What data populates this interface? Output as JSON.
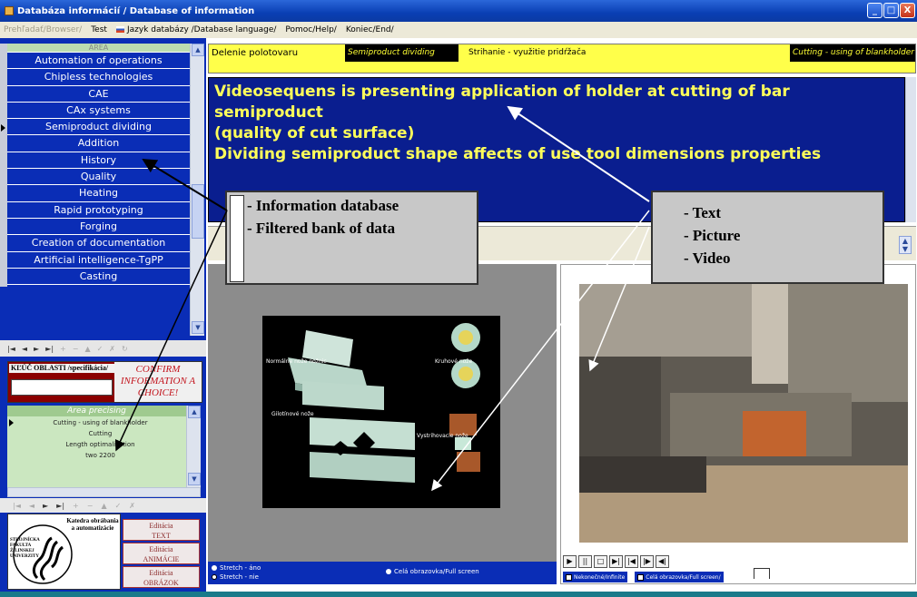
{
  "window": {
    "title": "Databáza informácií / Database of information",
    "controls": [
      "_",
      "□",
      "X"
    ]
  },
  "menu": {
    "items": [
      {
        "label": "Prehľadať/Browser/",
        "enabled": false
      },
      {
        "label": "Test",
        "enabled": true
      },
      {
        "label": "Jazyk databázy /Database language/",
        "enabled": true
      },
      {
        "label": "Pomoc/Help/",
        "enabled": true
      },
      {
        "label": "Koniec/End/",
        "enabled": true
      }
    ]
  },
  "area": {
    "header": "AREA",
    "items": [
      "Automation of operations",
      "Chipless technologies",
      "CAE",
      "CAx systems",
      "Semiproduct dividing",
      "Addition",
      "History",
      "Quality",
      "Heating",
      "Rapid prototyping",
      "Forging",
      "Creation of documentation",
      "Artificial intelligence-TgPP",
      "Casting"
    ],
    "selected_index": 4
  },
  "navigator": {
    "buttons": [
      "|◄",
      "◄",
      "►",
      "►|",
      "+",
      "−",
      "▲",
      "✓",
      "✗",
      "↻"
    ]
  },
  "key": {
    "label": "KĽÚČ OBLASTI /specifikácia/",
    "input_value": "",
    "confirm_text": "CONFIRM INFORMATION A CHOICE!"
  },
  "precising": {
    "header": "Area precising",
    "items": [
      "Cutting - using of blankholder",
      "Cutting",
      "Length optimalization",
      "two 2200"
    ],
    "selected_index": 0
  },
  "logo": {
    "title": "Katedra obrábania a automatizácie",
    "university": "STROJNÍCKA FAKULTA ŽILINSKEJ UNIVERZITY"
  },
  "edit_buttons": [
    {
      "line1": "Editácia",
      "line2": "TEXT"
    },
    {
      "line1": "Editácia",
      "line2": "ANIMÁCIE"
    },
    {
      "line1": "Editácia",
      "line2": "OBRÁZOK"
    }
  ],
  "text_header": {
    "area_sk": "Delenie polotovaru",
    "area_en": "Semiproduct dividing",
    "topic_sk": "Strihanie - využitie pridŕžača",
    "topic_en": "Cutting - using of blankholder"
  },
  "main_text": {
    "line1": "Videosequens is presenting application of holder at cutting of bar semiproduct",
    "line2": "(quality of cut surface)",
    "line3": "Dividing semiproduct shape affects of use tool dimensions properties"
  },
  "picture": {
    "labels": [
      "Normálne nože nožnic",
      "Kruhové nože",
      "Gilotínové nože",
      "Vystrihovacie nože"
    ]
  },
  "picture_controls": {
    "stretch_yes": "Stretch - áno",
    "stretch_no": "Stretch - nie",
    "fullscreen": "Celá obrazovka/Full screen"
  },
  "video_controls": {
    "buttons": [
      "▶",
      "||",
      "□",
      "▶|",
      "|◀",
      "|▶",
      "◀|"
    ],
    "loop_label": "Nekonečné/Infinite",
    "fullscreen_label": "Celá obrazovka/Full screen/"
  },
  "callouts": {
    "left": [
      "- Information database",
      "- Filtered bank of data"
    ],
    "right": [
      "- Text",
      "- Picture",
      "- Video"
    ]
  }
}
